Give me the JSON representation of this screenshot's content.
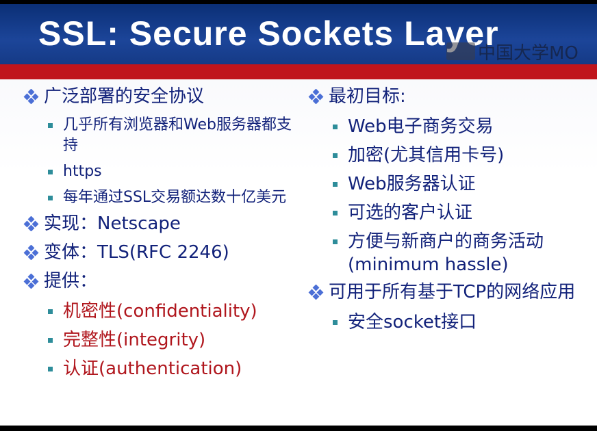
{
  "slide": {
    "title": "SSL: Secure Sockets Layer",
    "watermark": "中国大学MO",
    "left_column": {
      "i1": "广泛部署的安全协议",
      "i1_sub1": "几乎所有浏览器和Web服务器都支持",
      "i1_sub2": "https",
      "i1_sub3": "每年通过SSL交易额达数十亿美元",
      "i2": "实现：Netscape",
      "i3": "变体：TLS(RFC 2246)",
      "i4": "提供：",
      "i4_sub1": "机密性(confidentiality)",
      "i4_sub2": "完整性(integrity)",
      "i4_sub3": "认证(authentication)"
    },
    "right_column": {
      "i1": "最初目标:",
      "i1_sub1": "Web电子商务交易",
      "i1_sub2": "加密(尤其信用卡号)",
      "i1_sub3": "Web服务器认证",
      "i1_sub4": "可选的客户认证",
      "i1_sub5": "方便与新商户的商务活动(minimum hassle)",
      "i2": "可用于所有基于TCP的网络应用",
      "i2_sub1": "安全socket接口"
    },
    "colors": {
      "title_bar": "#153a86",
      "red_band": "#c0151c",
      "text_blue": "#12227a",
      "text_red": "#b0161d",
      "bullet_teal": "#2e8d9a"
    }
  }
}
